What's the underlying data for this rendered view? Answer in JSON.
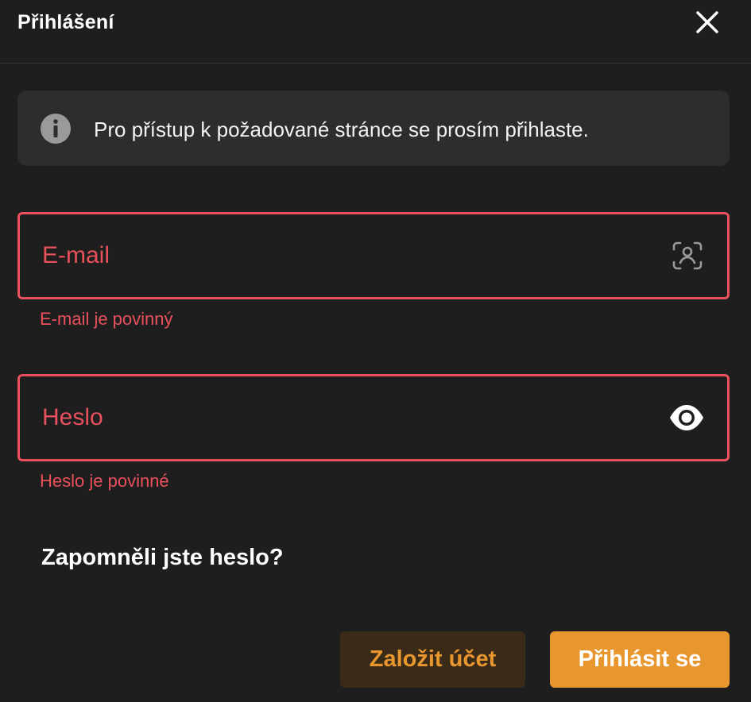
{
  "dialog": {
    "title": "Přihlášení",
    "close_icon": "close-icon"
  },
  "info": {
    "icon": "info-icon",
    "message": "Pro přístup k požadované stránce se prosím přihlaste."
  },
  "form": {
    "email": {
      "placeholder": "E-mail",
      "value": "",
      "icon": "user-scan-icon",
      "error": "E-mail je povinný"
    },
    "password": {
      "placeholder": "Heslo",
      "value": "",
      "icon": "eye-icon",
      "error": "Heslo je povinné"
    },
    "forgot_label": "Zapomněli jste heslo?"
  },
  "actions": {
    "register_label": "Založit účet",
    "login_label": "Přihlásit se"
  },
  "colors": {
    "background": "#1e1e1e",
    "info_background": "#2d2d2d",
    "error": "#e8505b",
    "accent": "#e8962e",
    "secondary_button": "#3a2a18"
  }
}
